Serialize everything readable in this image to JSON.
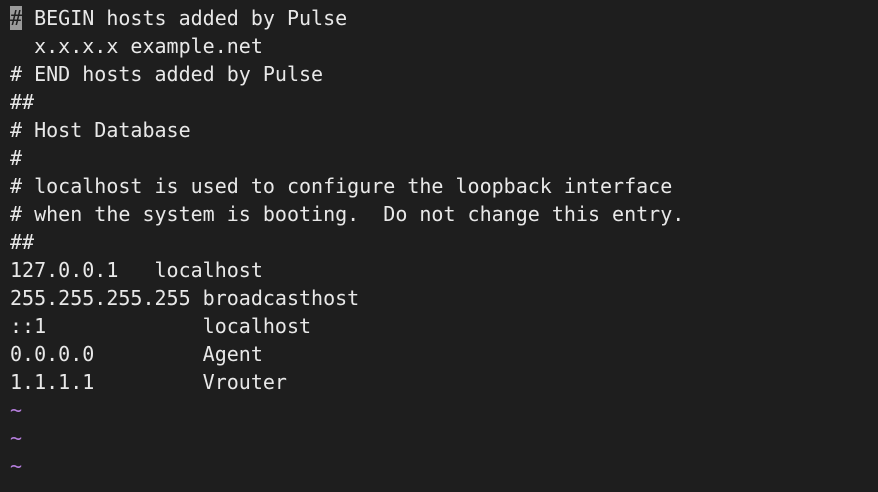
{
  "editor": {
    "cursor_char": "#",
    "lines": [
      " BEGIN hosts added by Pulse",
      "  x.x.x.x example.net",
      "# END hosts added by Pulse",
      "##",
      "# Host Database",
      "#",
      "# localhost is used to configure the loopback interface",
      "# when the system is booting.  Do not change this entry.",
      "##",
      "127.0.0.1   localhost",
      "255.255.255.255 broadcasthost",
      "::1             localhost",
      "0.0.0.0         Agent",
      "1.1.1.1         Vrouter"
    ],
    "empty_markers": [
      "~",
      "~",
      "~"
    ]
  },
  "colors": {
    "background": "#1e1e1e",
    "text": "#e8e8e8",
    "cursor": "#9a9a9a",
    "empty_marker": "#b57edc"
  }
}
